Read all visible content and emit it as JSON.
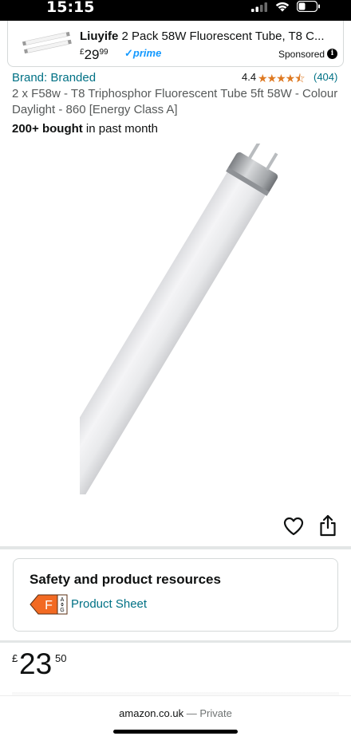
{
  "status_bar": {
    "time": "15:15",
    "icons": [
      "cellular-signal-icon",
      "wifi-icon",
      "battery-icon"
    ]
  },
  "sponsored_ad": {
    "brand": "Liuyife",
    "title": "2 Pack 58W Fluorescent Tube, T8 C...",
    "price_currency": "£",
    "price_whole": "29",
    "price_fraction": "99",
    "prime_label": "prime",
    "sponsored_label": "Sponsored",
    "info_icon": "i"
  },
  "product": {
    "brand_link": "Brand: Branded",
    "rating": "4.4",
    "stars": "★★★★⯪",
    "rating_count": "(404)",
    "title": "2 x F58w - T8 Triphosphor Fluorescent Tube 5ft 58W - Colour Daylight - 860 [Energy Class A]",
    "bought_bold": "200+ bought",
    "bought_rest": " in past month",
    "image_alt": "fluorescent-tube"
  },
  "actions": {
    "wishlist_icon": "heart-outline-icon",
    "share_icon": "share-icon"
  },
  "safety": {
    "title": "Safety and product resources",
    "energy_class": "F",
    "energy_scale_top": "A",
    "energy_scale_bottom": "G",
    "product_sheet_link": "Product Sheet"
  },
  "price": {
    "currency": "£",
    "whole": "23",
    "fraction": "50"
  },
  "browser": {
    "domain": "amazon.co.uk",
    "separator": " — ",
    "mode": "Private"
  },
  "colors": {
    "link": "#007185",
    "stars": "#de7921",
    "prime": "#1399ff",
    "energy_badge": "#f26a23"
  }
}
